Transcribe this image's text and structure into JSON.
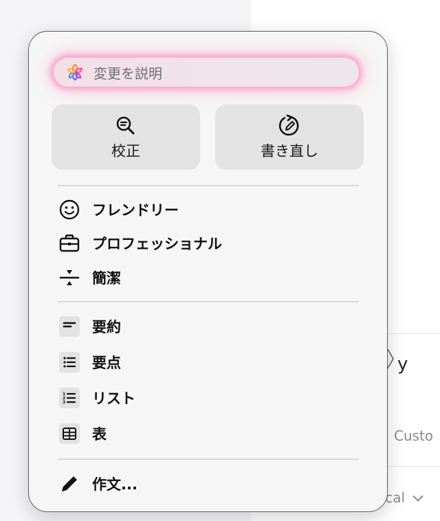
{
  "background": {
    "custom_text": "Custo",
    "local_text": "ocal"
  },
  "menu": {
    "describe_placeholder": "変更を説明",
    "proofread_label": "校正",
    "rewrite_label": "書き直し",
    "tone_items": [
      {
        "label": "フレンドリー",
        "icon": "smiley-icon"
      },
      {
        "label": "プロフェッショナル",
        "icon": "briefcase-icon"
      },
      {
        "label": "簡潔",
        "icon": "compress-icon"
      }
    ],
    "format_items": [
      {
        "label": "要約",
        "icon": "summary-icon"
      },
      {
        "label": "要点",
        "icon": "bullet-list-icon"
      },
      {
        "label": "リスト",
        "icon": "numbered-list-icon"
      },
      {
        "label": "表",
        "icon": "table-icon"
      }
    ],
    "compose_label": "作文..."
  },
  "colors": {
    "glow": "#ff78b4",
    "button_bg": "#e3e3e3",
    "popover_bg": "#f6f6f6"
  }
}
